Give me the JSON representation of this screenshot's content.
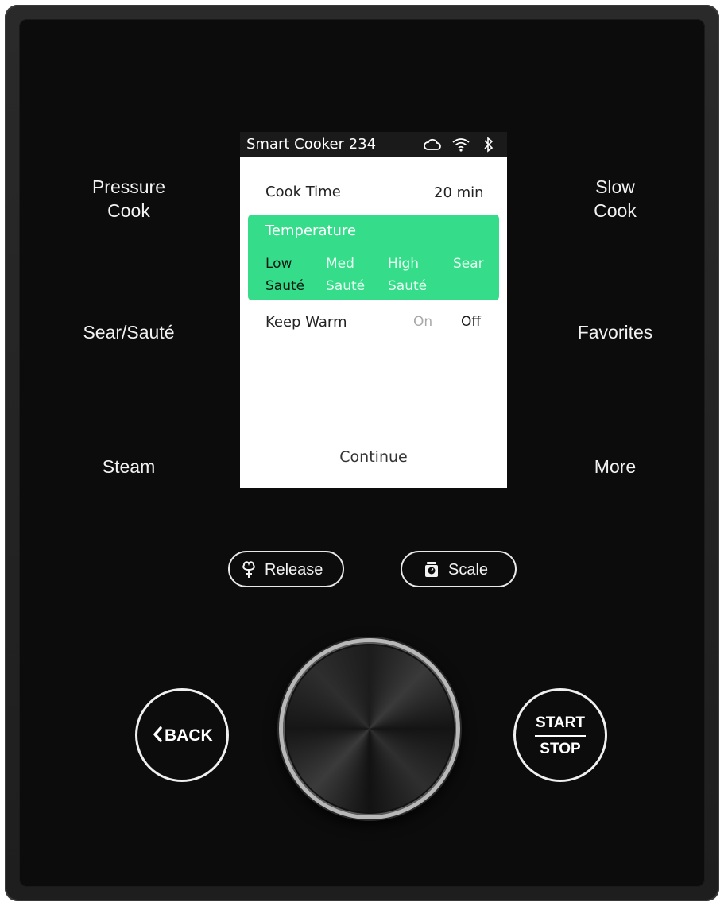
{
  "device": {
    "left_modes": [
      "Pressure Cook",
      "Sear/Sauté",
      "Steam"
    ],
    "right_modes": [
      "Slow Cook",
      "Favorites",
      "More"
    ]
  },
  "screen": {
    "title": "Smart Cooker 234",
    "status_icons": [
      "cloud-icon",
      "wifi-icon",
      "bluetooth-icon"
    ],
    "cook_time": {
      "label": "Cook Time",
      "value": "20 min"
    },
    "temperature": {
      "label": "Temperature",
      "options": [
        {
          "line1": "Low",
          "line2": "Sauté",
          "selected": true
        },
        {
          "line1": "Med",
          "line2": "Sauté",
          "selected": false
        },
        {
          "line1": "High",
          "line2": "Sauté",
          "selected": false
        },
        {
          "line1": "Sear",
          "line2": "",
          "selected": false
        }
      ]
    },
    "keep_warm": {
      "label": "Keep Warm",
      "on": "On",
      "off": "Off",
      "selected": "Off"
    },
    "continue_label": "Continue",
    "highlight_color": "#35dc8a"
  },
  "buttons": {
    "release": {
      "label": "Release",
      "icon": "steam-release-icon"
    },
    "scale": {
      "label": "Scale",
      "icon": "scale-icon"
    },
    "back": {
      "label": "BACK",
      "icon": "chevron-left-icon"
    },
    "start": "START",
    "stop": "STOP"
  }
}
